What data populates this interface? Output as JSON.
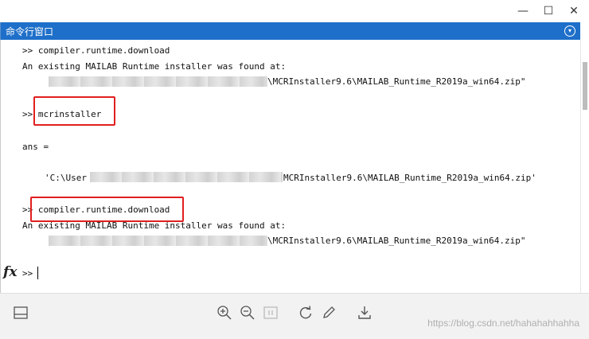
{
  "window": {
    "minimize_glyph": "—",
    "maximize_glyph": "☐",
    "close_glyph": "✕"
  },
  "panel": {
    "title": "命令行窗口",
    "menu_icon": "chevron-down-circle-icon"
  },
  "console": {
    "prompt": ">>",
    "lines": {
      "l1": ">> compiler.runtime.download",
      "l2": "An existing MAILAB Runtime installer was found at:",
      "l3": "\\MCRInstaller9.6\\MAILAB_Runtime_R2019a_win64.zip\"",
      "l4": ">> mcrinstaller",
      "l5": "ans =",
      "l6a": "'C:\\User",
      "l6b": "MCRInstaller9.6\\MAILAB_Runtime_R2019a_win64.zip'",
      "l7": ">> compiler.runtime.download",
      "l8": "An existing MAILAB Runtime installer was found at:",
      "l9": "\\MCRInstaller9.6\\MAILAB_Runtime_R2019a_win64.zip\"",
      "current_prompt": ">>"
    },
    "fx_label": "fx"
  },
  "toolbar": {
    "watermark": "https://blog.csdn.net/hahahahhahha"
  },
  "colors": {
    "panel_header": "#1e6fc9",
    "highlight_box": "#e11f1f"
  }
}
